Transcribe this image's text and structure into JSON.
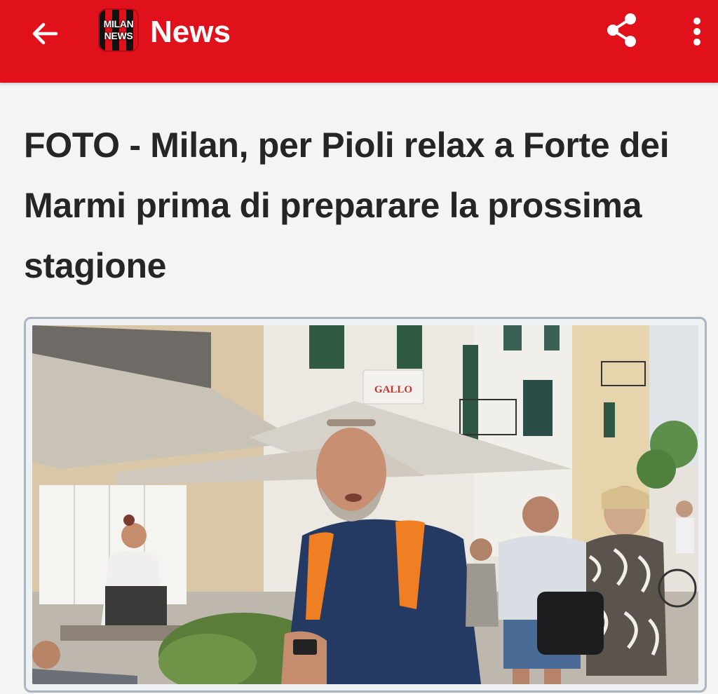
{
  "appbar": {
    "back_icon": "arrow-left-icon",
    "logo_line1": "MILAN",
    "logo_line2": "NEWS",
    "title": "News",
    "share_icon": "share-icon",
    "more_icon": "more-vertical-icon",
    "color": "#e0111b"
  },
  "article": {
    "headline": "FOTO - Milan, per Pioli relax a Forte dei Marmi prima di preparare la prossima stagione",
    "shop_sign": "GALLO"
  }
}
